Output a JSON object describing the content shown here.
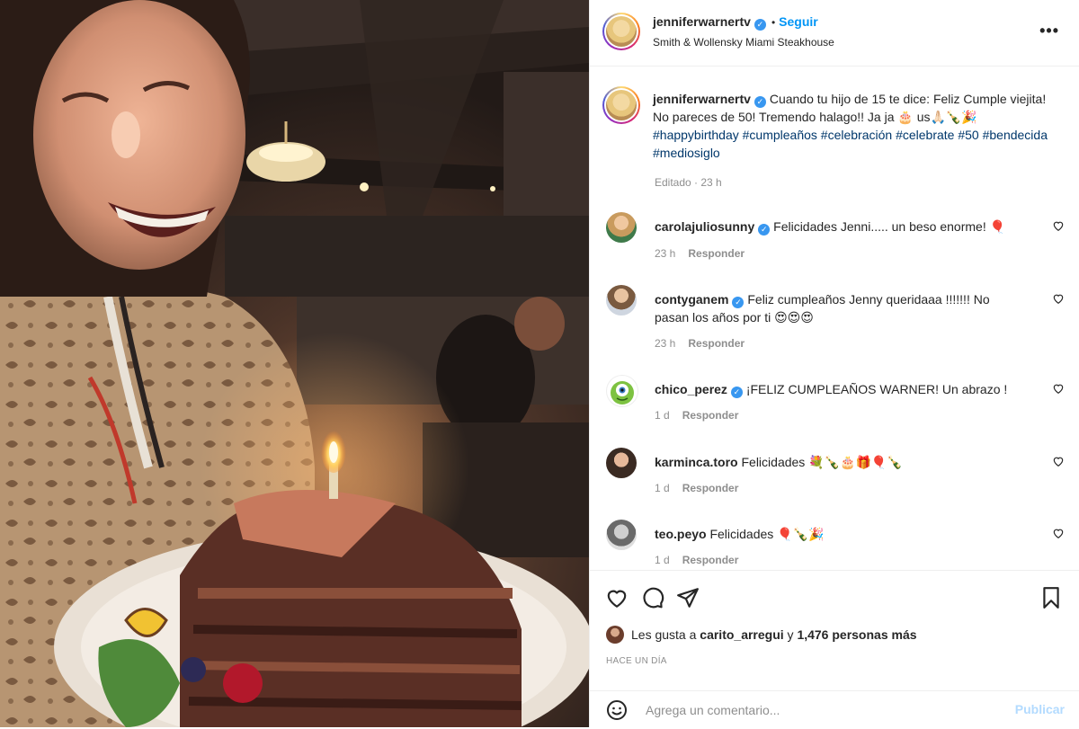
{
  "post": {
    "author": "jenniferwarnertv",
    "follow_label": "Seguir",
    "location": "Smith & Wollensky Miami Steakhouse",
    "more_glyph": "•••"
  },
  "caption": {
    "username": "jenniferwarnertv",
    "text": "Cuando tu hijo de 15 te dice: Feliz Cumple viejita! No pareces de 50! Tremendo halago!! Ja ja 🎂 us🙏🏻🍾🎉 ",
    "hashtags": "#happybirthday #cumpleaños #celebración #celebrate #50 #bendecida #mediosiglo",
    "edited": "Editado",
    "time": "23 h"
  },
  "comments": [
    {
      "username": "carolajuliosunny",
      "verified": true,
      "text": "Felicidades Jenni..... un beso enorme! 🎈",
      "time": "23 h",
      "reply": "Responder"
    },
    {
      "username": "contyganem",
      "verified": true,
      "text": "Feliz cumpleaños Jenny queridaaa !!!!!!! No pasan los años por ti 😍😍😍",
      "time": "23 h",
      "reply": "Responder"
    },
    {
      "username": "chico_perez",
      "verified": true,
      "text": "¡FELIZ CUMPLEAÑOS WARNER! Un abrazo !",
      "time": "1 d",
      "reply": "Responder"
    },
    {
      "username": "karminca.toro",
      "verified": false,
      "text": "Felicidades 💐🍾🎂🎁🎈🍾",
      "time": "1 d",
      "reply": "Responder"
    },
    {
      "username": "teo.peyo",
      "verified": false,
      "text": "Felicidades 🎈🍾🎉",
      "time": "1 d",
      "reply": "Responder"
    }
  ],
  "likes": {
    "prefix": "Les gusta a",
    "user": "carito_arregui",
    "joiner": "y",
    "others": "1,476 personas más"
  },
  "posted_when": "HACE UN DÍA",
  "add_comment": {
    "placeholder": "Agrega un comentario...",
    "publish_label": "Publicar"
  },
  "icons": {
    "like": "heart-icon",
    "comment": "comment-icon",
    "share": "share-icon",
    "save": "bookmark-icon",
    "emoji": "emoji-icon",
    "options": "more-options-icon"
  },
  "colors": {
    "accent": "#0095f6",
    "hashtag": "#00376b",
    "muted": "#8e8e8e",
    "verified": "#3897f0",
    "publish_disabled": "#b3dbff"
  }
}
